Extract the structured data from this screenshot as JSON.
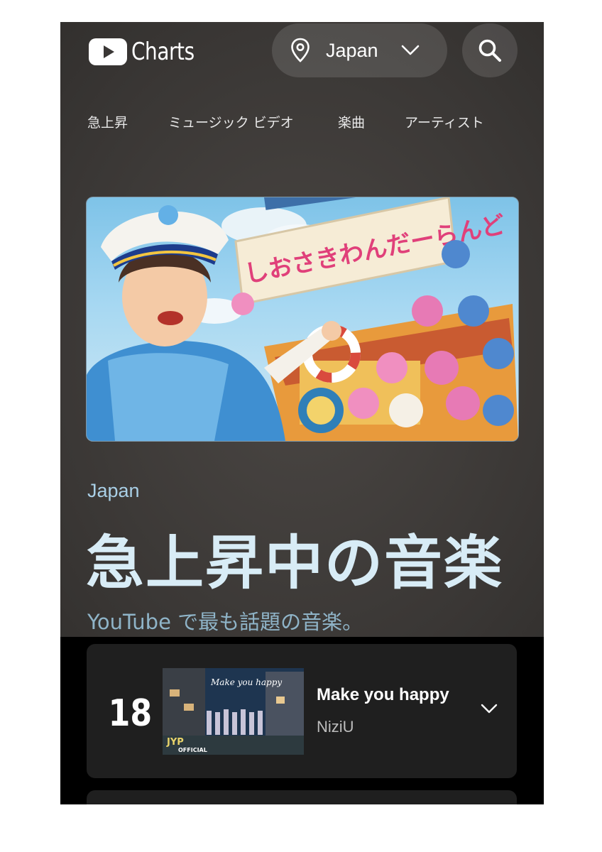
{
  "header": {
    "logo_text": "Charts",
    "country_selector": {
      "value": "Japan",
      "icon": "location-pin-icon",
      "chevron": "chevron-down-icon"
    },
    "search_icon": "search-icon"
  },
  "tabs": [
    {
      "label": "急上昇"
    },
    {
      "label": "ミュージック ビデオ"
    },
    {
      "label": "楽曲"
    },
    {
      "label": "アーティスト"
    }
  ],
  "hero": {
    "banner_text": "しおさきわんだーらんど"
  },
  "region": "Japan",
  "title": "急上昇中の音楽",
  "subtitle": "YouTube で最も話題の音楽。",
  "chart_list": [
    {
      "rank": "18",
      "title": "Make you happy",
      "artist": "NiziU",
      "thumbnail_text": "Make you happy",
      "thumbnail_logo": "JYP",
      "thumbnail_logo_sub": "OFFICIAL"
    }
  ],
  "colors": {
    "background": "#3a3735",
    "accent_text": "#a9cfe6",
    "card": "#1f1f1f"
  }
}
